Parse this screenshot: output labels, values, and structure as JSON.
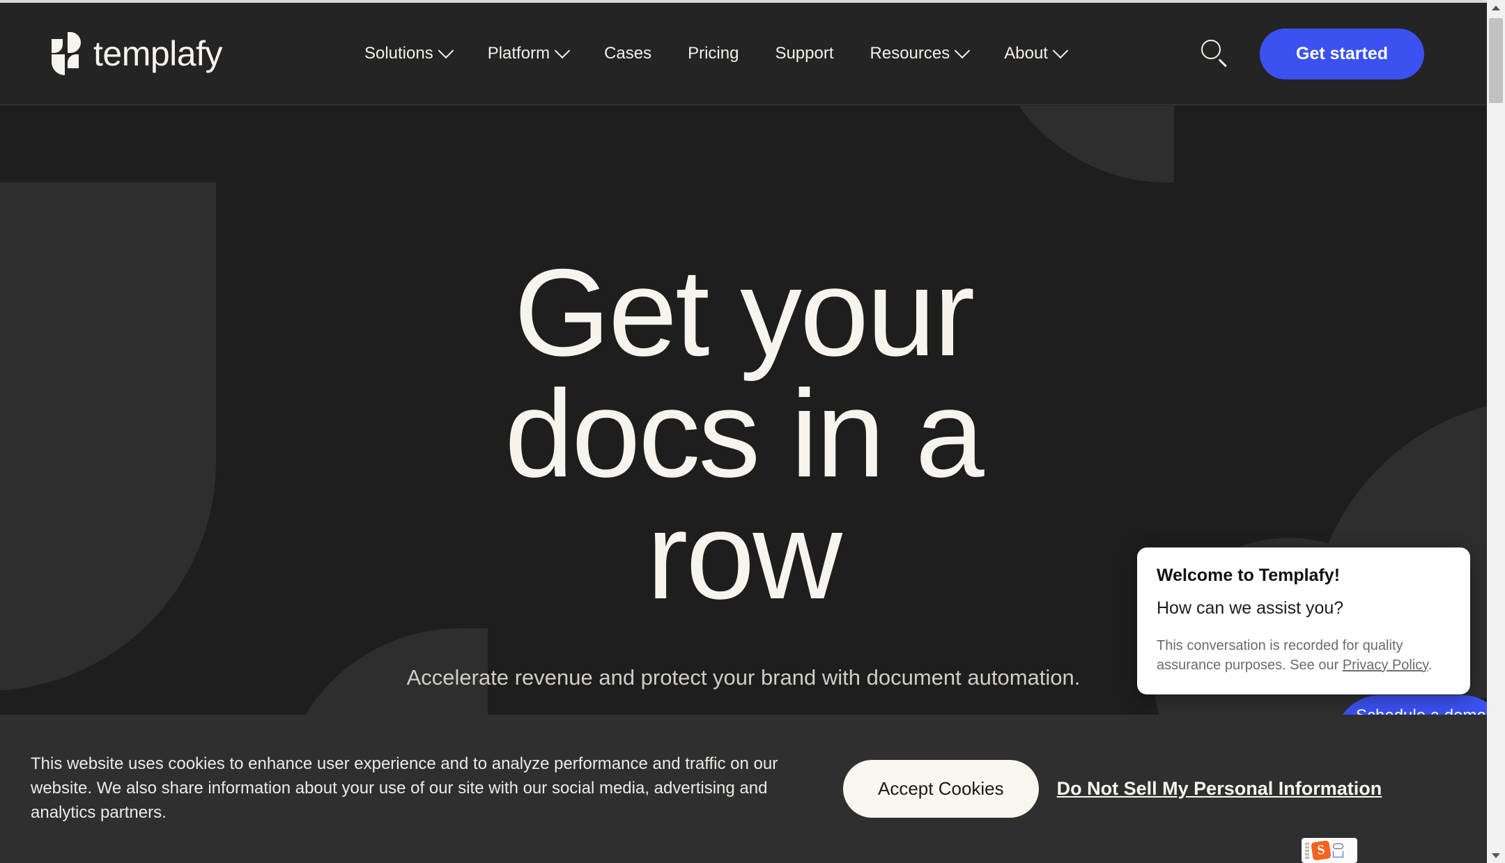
{
  "brand": {
    "name": "templafy",
    "logo_icon": "templafy-logo-mark",
    "accent_color": "#3b51f0",
    "dark_bg": "#1e1e1e",
    "cream": "#f6f4ec"
  },
  "header": {
    "nav_items": [
      {
        "label": "Solutions",
        "has_dropdown": true
      },
      {
        "label": "Platform",
        "has_dropdown": true
      },
      {
        "label": "Cases",
        "has_dropdown": false
      },
      {
        "label": "Pricing",
        "has_dropdown": false
      },
      {
        "label": "Support",
        "has_dropdown": false
      },
      {
        "label": "Resources",
        "has_dropdown": true
      },
      {
        "label": "About",
        "has_dropdown": true
      }
    ],
    "search_icon": "search-icon",
    "cta_label": "Get started"
  },
  "hero": {
    "title_line1": "Get your",
    "title_line2": "docs in a",
    "title_line3": "row",
    "subtitle": "Accelerate revenue and protect your brand with document automation."
  },
  "chat": {
    "title": "Welcome to Templafy!",
    "question": "How can we assist you?",
    "note_before": "This conversation is recorded for quality assurance purposes. See our ",
    "note_link": "Privacy Policy",
    "note_after": ".",
    "schedule_label": "Schedule a demo"
  },
  "cookies": {
    "text": "This website uses cookies to enhance user experience and to analyze performance and traffic on our website. We also share information about your use of our site with our social media, advertising and analytics partners.",
    "accept_label": "Accept Cookies",
    "do_not_sell_label": "Do Not Sell My Personal Information"
  },
  "ime": {
    "logo_letter": "S",
    "handle_icon": "drag-handle-icon",
    "pill_icon": "mode-pill-icon",
    "keyboard_icon": "keyboard-icon"
  },
  "scrollbar": {
    "up_icon": "scroll-up-arrow-icon",
    "down_icon": "scroll-down-arrow-icon",
    "thumb_icon": "scrollbar-thumb"
  }
}
